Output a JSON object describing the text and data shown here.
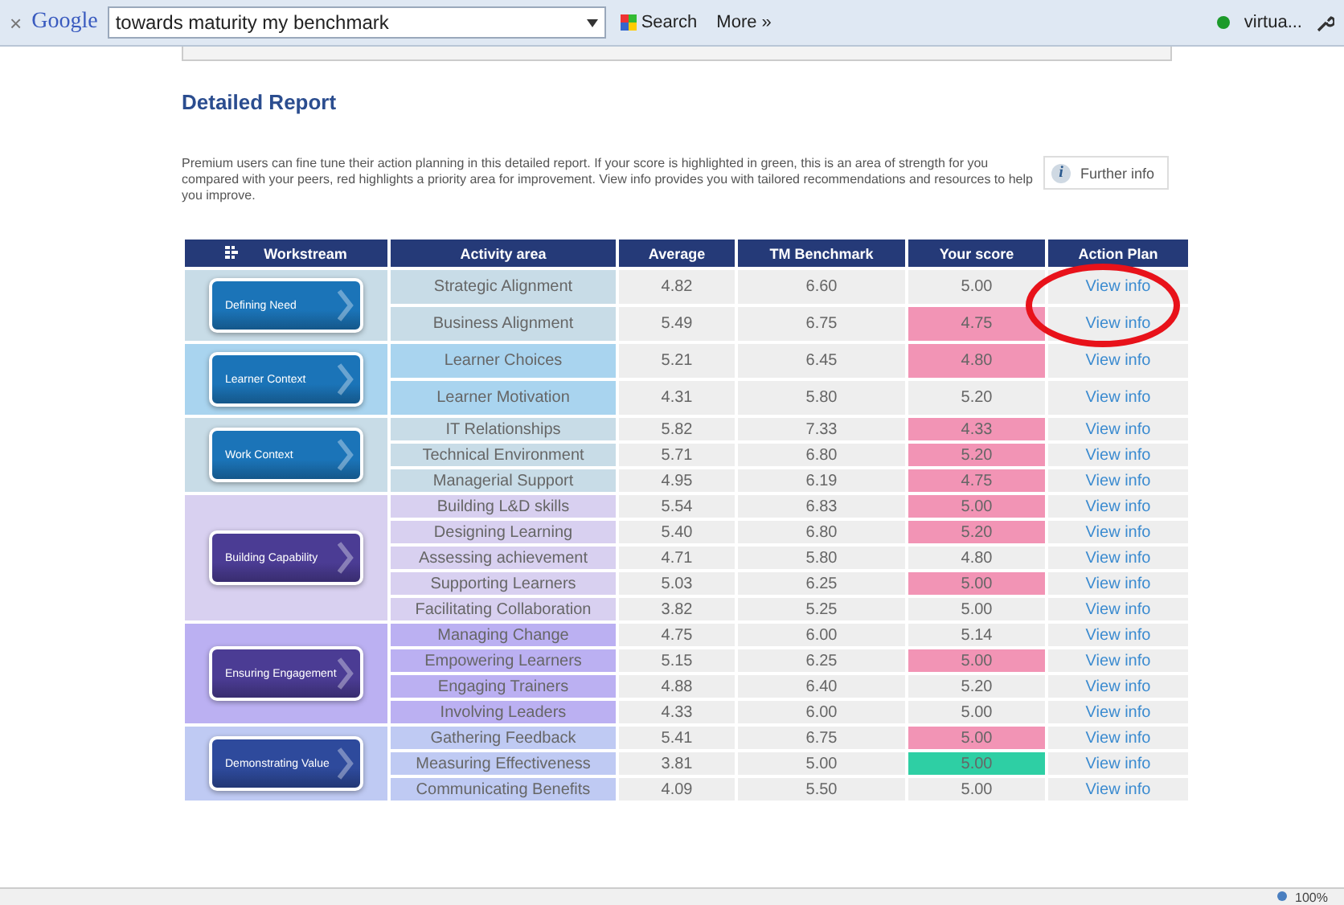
{
  "toolbar": {
    "close": "×",
    "logo": "Google",
    "query": "towards maturity my benchmark",
    "search_button": "Search",
    "more": "More »",
    "account": "virtua..."
  },
  "title": "Detailed Report",
  "intro": "Premium users can fine tune their action planning in this detailed report. If your score is highlighted in green, this is an area of strength for you compared with your peers, red highlights a priority area for improvement. View info provides you with tailored recommendations and resources to help you improve.",
  "further_info": {
    "icon": "i",
    "label": "Further info"
  },
  "table": {
    "columns": [
      "Workstream",
      "Activity area",
      "Average",
      "TM Benchmark",
      "Your score",
      "Action Plan"
    ],
    "groups": [
      {
        "workstream": "Defining Need",
        "color": "#c8dce7",
        "kind": "blue",
        "rows": [
          {
            "area": "Strategic Alignment",
            "average": "4.82",
            "benchmark": "6.60",
            "score": "5.00",
            "priority": false,
            "strength": false,
            "action": "View info"
          },
          {
            "area": "Business Alignment",
            "average": "5.49",
            "benchmark": "6.75",
            "score": "4.75",
            "priority": true,
            "strength": false,
            "action": "View info"
          }
        ]
      },
      {
        "workstream": "Learner Context",
        "color": "#a9d4ef",
        "kind": "blue",
        "rows": [
          {
            "area": "Learner Choices",
            "average": "5.21",
            "benchmark": "6.45",
            "score": "4.80",
            "priority": true,
            "strength": false,
            "action": "View info"
          },
          {
            "area": "Learner Motivation",
            "average": "4.31",
            "benchmark": "5.80",
            "score": "5.20",
            "priority": false,
            "strength": false,
            "action": "View info"
          }
        ]
      },
      {
        "workstream": "Work Context",
        "color": "#c8dce7",
        "kind": "blue",
        "rows": [
          {
            "area": "IT Relationships",
            "average": "5.82",
            "benchmark": "7.33",
            "score": "4.33",
            "priority": true,
            "strength": false,
            "action": "View info"
          },
          {
            "area": "Technical Environment",
            "average": "5.71",
            "benchmark": "6.80",
            "score": "5.20",
            "priority": true,
            "strength": false,
            "action": "View info"
          },
          {
            "area": "Managerial Support",
            "average": "4.95",
            "benchmark": "6.19",
            "score": "4.75",
            "priority": true,
            "strength": false,
            "action": "View info"
          }
        ]
      },
      {
        "workstream": "Building Capability",
        "color": "#d8d0f0",
        "kind": "violet",
        "rows": [
          {
            "area": "Building L&D skills",
            "average": "5.54",
            "benchmark": "6.83",
            "score": "5.00",
            "priority": true,
            "strength": false,
            "action": "View info"
          },
          {
            "area": "Designing Learning",
            "average": "5.40",
            "benchmark": "6.80",
            "score": "5.20",
            "priority": true,
            "strength": false,
            "action": "View info"
          },
          {
            "area": "Assessing achievement",
            "average": "4.71",
            "benchmark": "5.80",
            "score": "4.80",
            "priority": false,
            "strength": false,
            "action": "View info"
          },
          {
            "area": "Supporting Learners",
            "average": "5.03",
            "benchmark": "6.25",
            "score": "5.00",
            "priority": true,
            "strength": false,
            "action": "View info"
          },
          {
            "area": "Facilitating Collaboration",
            "average": "3.82",
            "benchmark": "5.25",
            "score": "5.00",
            "priority": false,
            "strength": false,
            "action": "View info"
          }
        ]
      },
      {
        "workstream": "Ensuring Engagement",
        "color": "#bbb0f2",
        "kind": "violet",
        "rows": [
          {
            "area": "Managing Change",
            "average": "4.75",
            "benchmark": "6.00",
            "score": "5.14",
            "priority": false,
            "strength": false,
            "action": "View info"
          },
          {
            "area": "Empowering Learners",
            "average": "5.15",
            "benchmark": "6.25",
            "score": "5.00",
            "priority": true,
            "strength": false,
            "action": "View info"
          },
          {
            "area": "Engaging Trainers",
            "average": "4.88",
            "benchmark": "6.40",
            "score": "5.20",
            "priority": false,
            "strength": false,
            "action": "View info"
          },
          {
            "area": "Involving Leaders",
            "average": "4.33",
            "benchmark": "6.00",
            "score": "5.00",
            "priority": false,
            "strength": false,
            "action": "View info"
          }
        ]
      },
      {
        "workstream": "Demonstrating Value",
        "color": "#bfcaf3",
        "kind": "navy",
        "rows": [
          {
            "area": "Gathering Feedback",
            "average": "5.41",
            "benchmark": "6.75",
            "score": "5.00",
            "priority": true,
            "strength": false,
            "action": "View info"
          },
          {
            "area": "Measuring Effectiveness",
            "average": "3.81",
            "benchmark": "5.00",
            "score": "5.00",
            "priority": false,
            "strength": true,
            "action": "View info"
          },
          {
            "area": "Communicating Benefits",
            "average": "4.09",
            "benchmark": "5.50",
            "score": "5.00",
            "priority": false,
            "strength": false,
            "action": "View info"
          }
        ]
      }
    ]
  },
  "status_bar": {
    "zoom": "100%"
  }
}
